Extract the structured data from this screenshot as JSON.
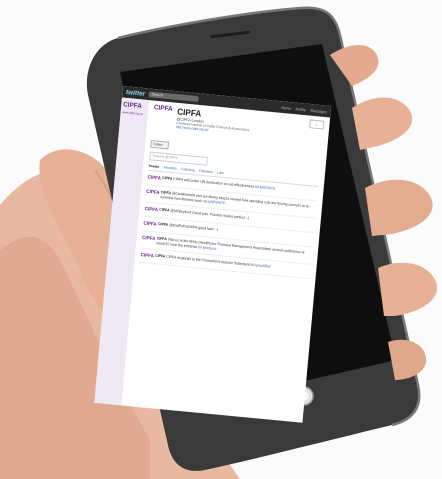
{
  "twitter_bar": {
    "logo": "twitter",
    "search_placeholder": "Search",
    "nav": [
      "Home",
      "Profile",
      "Messages"
    ]
  },
  "sidebar": {
    "logo": "CIPFA",
    "url": "www.cipfa.org.uk"
  },
  "profile": {
    "avatar_text": "CIPFA",
    "name": "CIPFA",
    "handle": "@CIPFA London",
    "description": "Chartered Institute of Public Finance & Accountancy",
    "url": "http://www.cipfa.org.uk/",
    "follow_label": "Follow",
    "user_menu": "↓"
  },
  "tweet_box": {
    "placeholder": "Tweet to @CIPFA"
  },
  "tabs": [
    "Tweets",
    "Favorites",
    "Following",
    "Followers",
    "Lists"
  ],
  "tweets": [
    {
      "author": "CIPFA",
      "text": "CIPFA welcomes UN declaration on aid effectiveness",
      "link": "bit.ly/rB7bPG"
    },
    {
      "author": "CIPFA",
      "text": "@ContlmeiraM visit our library blog to viewed how spending cuts are forcing councils to re-examine how libraries work",
      "link": "ow.ly/9ROwTP"
    },
    {
      "author": "CIPFA",
      "text": "@UKBeyfund Great cuts. Practice makes perfect :-)",
      "link": ""
    },
    {
      "author": "CIPFA",
      "text": "@EndPeFinCIPFA good luck! :-)",
      "link": ""
    },
    {
      "author": "CIPFA",
      "text": "Visit us at the Milne (Healthcare Financial Management Association) annual conference at stand 67 near the entrance",
      "link": "bit.ly/sXjuUr"
    },
    {
      "author": "CIPFA",
      "text": "CIPFA responds to the Chancellor's Autumn Statement",
      "link": "bit.ly/uvX8b9"
    }
  ]
}
